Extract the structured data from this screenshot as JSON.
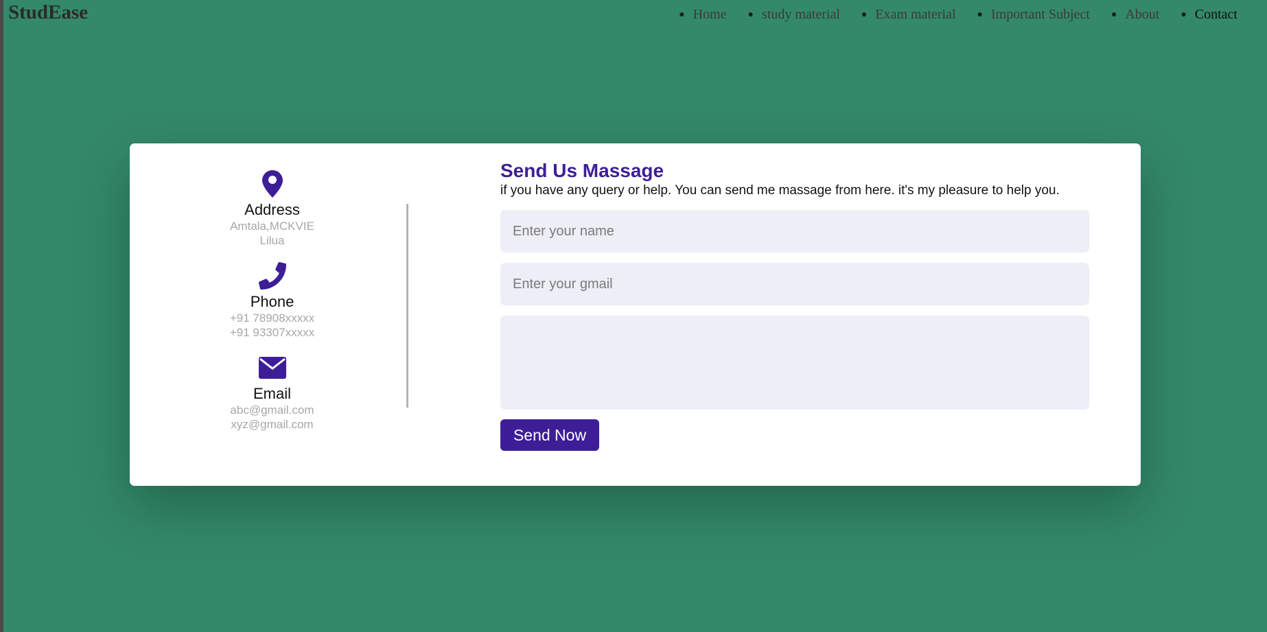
{
  "brand": "StudEase",
  "nav": {
    "items": [
      {
        "label": "Home"
      },
      {
        "label": "study material"
      },
      {
        "label": "Exam material"
      },
      {
        "label": "Important Subject"
      },
      {
        "label": "About"
      },
      {
        "label": "Contact"
      }
    ],
    "active": "Contact"
  },
  "contact": {
    "address": {
      "title": "Address",
      "lines": [
        "Amtala,MCKVIE",
        "Lilua"
      ],
      "icon": "map-pin-icon"
    },
    "phone": {
      "title": "Phone",
      "lines": [
        "+91 78908xxxxx",
        "+91 93307xxxxx"
      ],
      "icon": "phone-icon"
    },
    "email": {
      "title": "Email",
      "lines": [
        "abc@gmail.com",
        "xyz@gmail.com"
      ],
      "icon": "envelope-icon"
    }
  },
  "form": {
    "title": "Send Us Massage",
    "subtitle": "if you have any query or help. You can send me massage from here. it's my pleasure to help you.",
    "name_placeholder": "Enter your name",
    "name_value": "",
    "email_placeholder": "Enter your gmail",
    "email_value": "",
    "message_placeholder": "",
    "message_value": "",
    "submit_label": "Send Now"
  },
  "colors": {
    "background": "#34896a",
    "accent": "#3e1e97",
    "input_bg": "#eeeef7"
  }
}
